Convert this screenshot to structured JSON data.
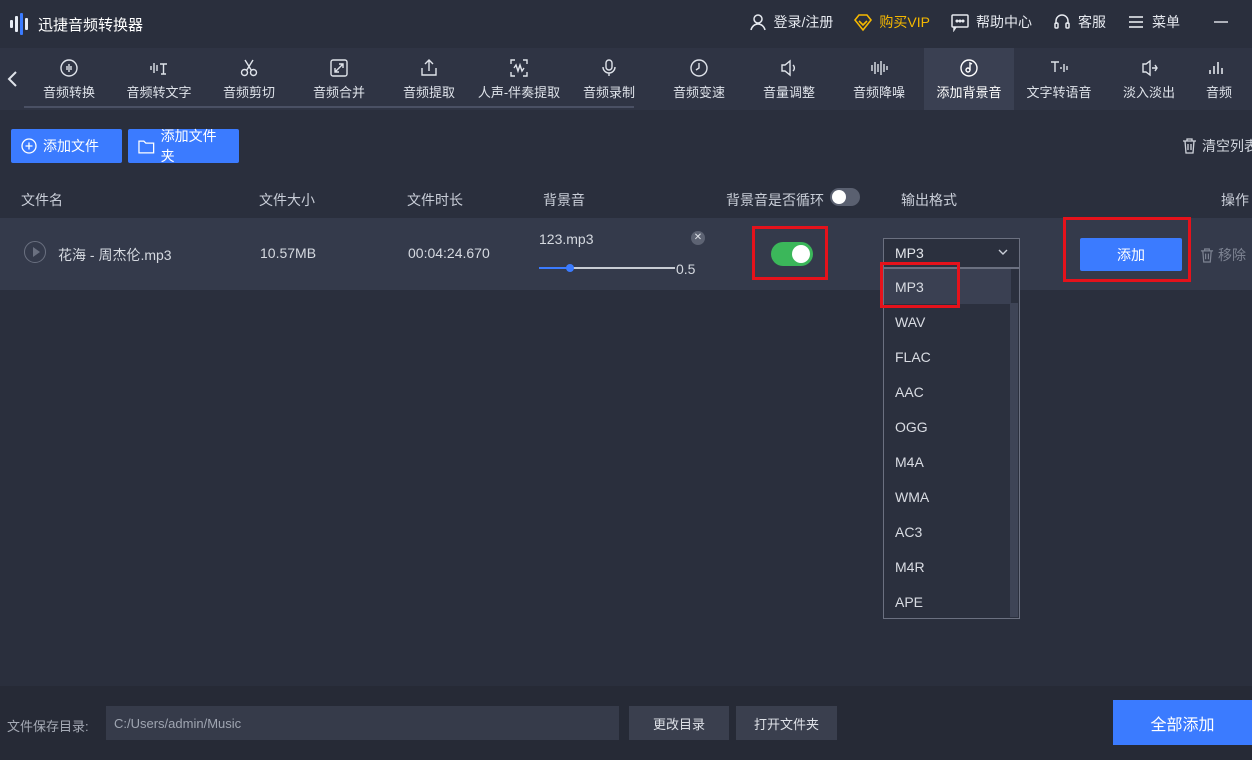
{
  "app": {
    "title": "迅捷音频转换器"
  },
  "top": {
    "login": "登录/注册",
    "vip": "购买VIP",
    "help": "帮助中心",
    "service": "客服",
    "menu": "菜单"
  },
  "tools": [
    {
      "label": "音频转换",
      "icon": "audio-convert-icon"
    },
    {
      "label": "音频转文字",
      "icon": "speech-to-text-icon"
    },
    {
      "label": "音频剪切",
      "icon": "scissors-icon"
    },
    {
      "label": "音频合并",
      "icon": "merge-icon"
    },
    {
      "label": "音频提取",
      "icon": "extract-icon"
    },
    {
      "label": "人声-伴奏提取",
      "icon": "vocal-extract-icon"
    },
    {
      "label": "音频录制",
      "icon": "microphone-icon"
    },
    {
      "label": "音频变速",
      "icon": "speed-icon"
    },
    {
      "label": "音量调整",
      "icon": "volume-icon"
    },
    {
      "label": "音频降噪",
      "icon": "denoise-icon"
    },
    {
      "label": "添加背景音",
      "icon": "music-note-icon"
    },
    {
      "label": "文字转语音",
      "icon": "text-to-speech-icon"
    },
    {
      "label": "淡入淡出",
      "icon": "fade-icon"
    },
    {
      "label": "音频",
      "icon": "bars-icon"
    }
  ],
  "actions": {
    "add_file": "添加文件",
    "add_folder": "添加文件夹",
    "clear_list": "清空列表"
  },
  "table": {
    "headers": {
      "name": "文件名",
      "size": "文件大小",
      "duration": "文件时长",
      "bg": "背景音",
      "loop": "背景音是否循环",
      "format": "输出格式",
      "op": "操作"
    },
    "row": {
      "name": "花海 - 周杰伦.mp3",
      "size": "10.57MB",
      "duration": "00:04:24.670",
      "bg_file": "123.mp3",
      "bg_volume": 0.5,
      "bg_volume_label": "0.5",
      "loop": true,
      "format": "MP3",
      "add": "添加",
      "remove": "移除"
    }
  },
  "dropdown": {
    "selected": "MP3",
    "options": [
      "MP3",
      "WAV",
      "FLAC",
      "AAC",
      "OGG",
      "M4A",
      "WMA",
      "AC3",
      "M4R",
      "APE"
    ]
  },
  "bottom": {
    "save_label": "文件保存目录:",
    "path": "C:/Users/admin/Music",
    "change_dir": "更改目录",
    "open_folder": "打开文件夹",
    "add_all": "全部添加"
  },
  "colors": {
    "accent": "#3b7bff",
    "toggle_on": "#3bb75a",
    "highlight": "#e5121b",
    "vip": "#f5b800"
  }
}
